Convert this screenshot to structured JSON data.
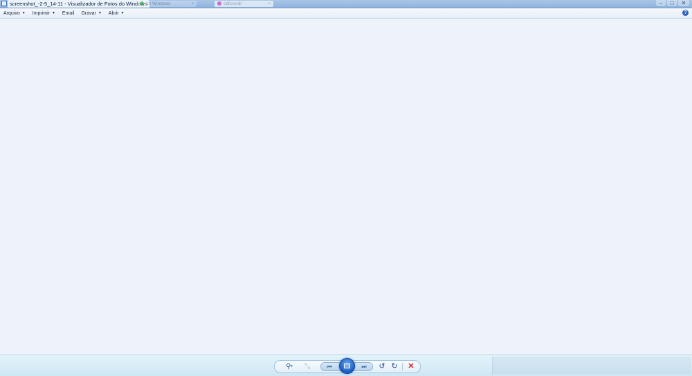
{
  "window": {
    "title": "screenshot_-2-5_14-11 - Visualizador de Fotos do Windows",
    "background_tabs": [
      {
        "label": "10 Windows",
        "close": "×"
      },
      {
        "label": "cdfsvsrdr",
        "close": "×"
      }
    ],
    "controls": {
      "minimize": "–",
      "maximize": "□",
      "close": "✕"
    }
  },
  "menu": {
    "items": [
      {
        "label": "Arquivo",
        "has_dropdown": true
      },
      {
        "label": "Imprimir",
        "has_dropdown": true
      },
      {
        "label": "Email",
        "has_dropdown": false
      },
      {
        "label": "Gravar",
        "has_dropdown": true
      },
      {
        "label": "Abrir",
        "has_dropdown": true
      }
    ],
    "dropdown_glyph": "▼",
    "help_glyph": "?"
  },
  "toolbar": {
    "zoom_glyph": "⚲",
    "zoom_arrow": "▾",
    "fit_glyph": "⤡",
    "previous_glyph": "⏮",
    "next_glyph": "⏭",
    "rotate_left_glyph": "↺",
    "rotate_right_glyph": "↻",
    "delete_glyph": "✕"
  },
  "colors": {
    "window_bg": "#eef3fb",
    "toolbar_bg": "#d9edf7",
    "accent": "#1b5cc2",
    "delete": "#d01c1c"
  }
}
